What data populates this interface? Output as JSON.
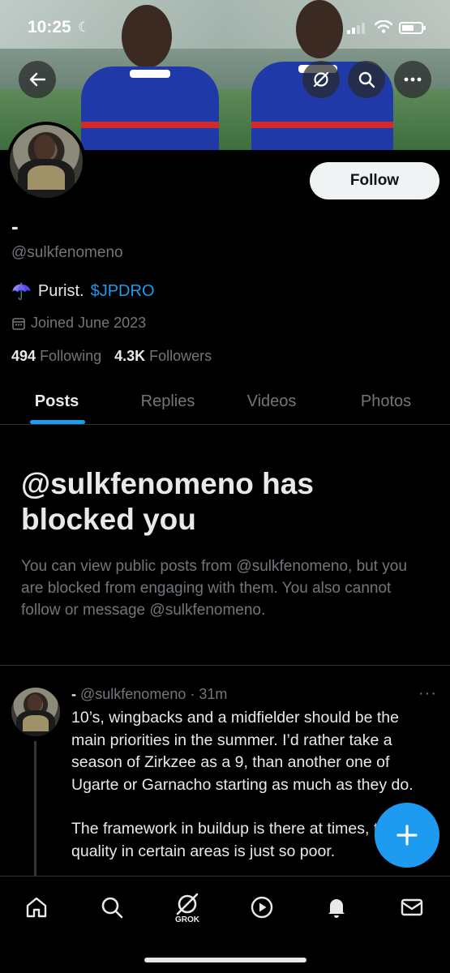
{
  "status_bar": {
    "time": "10:25"
  },
  "profile": {
    "display_name": "-",
    "handle": "@sulkfenomeno",
    "bio_emoji": "☂️",
    "bio_text": "Purist.",
    "bio_link": "$JPDRO",
    "joined": "Joined June 2023",
    "following_count": "494",
    "following_label": "Following",
    "followers_count": "4.3K",
    "followers_label": "Followers",
    "follow_label": "Follow"
  },
  "tabs": [
    {
      "label": "Posts",
      "active": true
    },
    {
      "label": "Replies",
      "active": false
    },
    {
      "label": "Videos",
      "active": false
    },
    {
      "label": "Photos",
      "active": false
    }
  ],
  "blocked": {
    "title": "@sulkfenomeno has blocked you",
    "description": "You can view public posts from @sulkfenomeno, but you are blocked from engaging with them. You also cannot follow or message @sulkfenomeno."
  },
  "post": {
    "name": "-",
    "handle": "@sulkfenomeno",
    "separator": "·",
    "time": "31m",
    "more": "···",
    "paragraph1": "10’s, wingbacks and a midfielder should be the main priorities in the summer. I’d rather take a season of Zirkzee as a 9, than another one of Ugarte or Garnacho starting as much as they do.",
    "paragraph2": "The framework in buildup is there at times, the quality in certain areas is just so poor."
  },
  "nav": {
    "grok_label": "GROK",
    "icons": [
      "home-icon",
      "search-icon",
      "grok-icon",
      "play-icon",
      "bell-icon",
      "mail-icon"
    ]
  },
  "colors": {
    "accent": "#1d9bf0",
    "background": "#000000",
    "muted": "#71767b",
    "text": "#e7e9ea"
  }
}
